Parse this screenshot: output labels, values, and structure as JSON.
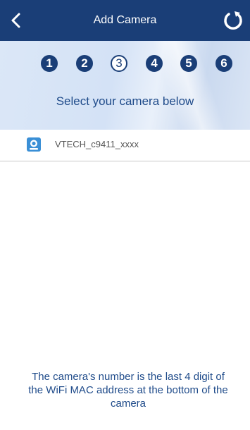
{
  "header": {
    "title": "Add Camera",
    "back_icon": "chevron-left-icon",
    "refresh_icon": "refresh-icon",
    "bar_color": "#1a3e77"
  },
  "steps": {
    "items": [
      {
        "label": "1",
        "state": "done"
      },
      {
        "label": "2",
        "state": "done"
      },
      {
        "label": "3",
        "state": "current"
      },
      {
        "label": "4",
        "state": "todo"
      },
      {
        "label": "5",
        "state": "todo"
      },
      {
        "label": "6",
        "state": "todo"
      }
    ],
    "current": 3,
    "total": 6
  },
  "instruction": "Select your camera below",
  "cameras": [
    {
      "name": "VTECH_c9411_xxxx",
      "icon": "camera-icon"
    }
  ],
  "footer_note": {
    "line1": "The camera's number is the last 4 digit of",
    "line2": "the WiFi MAC address at the bottom of the",
    "line3": "camera"
  },
  "colors": {
    "accent": "#1f4b8a",
    "header": "#1a3e77",
    "icon_blue": "#3a8fd6"
  }
}
